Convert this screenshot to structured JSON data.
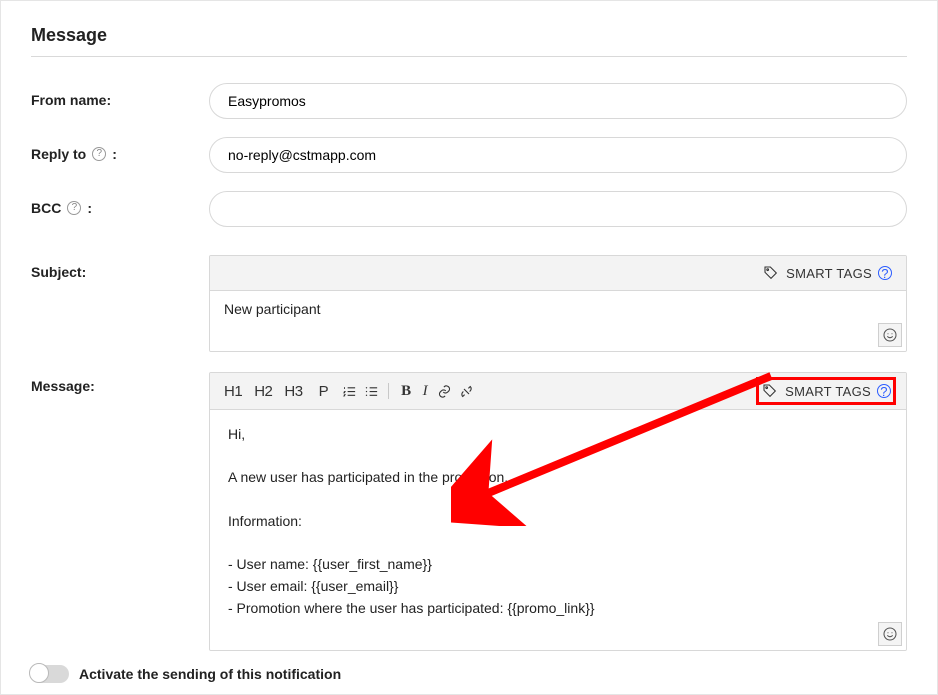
{
  "section_title": "Message",
  "labels": {
    "from_name": "From name:",
    "reply_to": "Reply to",
    "reply_to_colon": ":",
    "bcc": "BCC",
    "bcc_colon": ":",
    "subject": "Subject:",
    "message": "Message:"
  },
  "fields": {
    "from_name": "Easypromos",
    "reply_to": "no-reply@cstmapp.com",
    "bcc": ""
  },
  "smart_tags_label": "SMART TAGS",
  "subject_value": "New participant",
  "toolbar": {
    "h1": "H1",
    "h2": "H2",
    "h3": "H3",
    "p": "P",
    "bold": "B",
    "italic": "I"
  },
  "message_body": "Hi,\n\nA new user has participated in the promotion.\n\nInformation:\n\n- User name: {{user_first_name}}\n- User email: {{user_email}}\n- Promotion where the user has participated: {{promo_link}}",
  "toggle": {
    "state": false,
    "label": "Activate the sending of this notification"
  }
}
